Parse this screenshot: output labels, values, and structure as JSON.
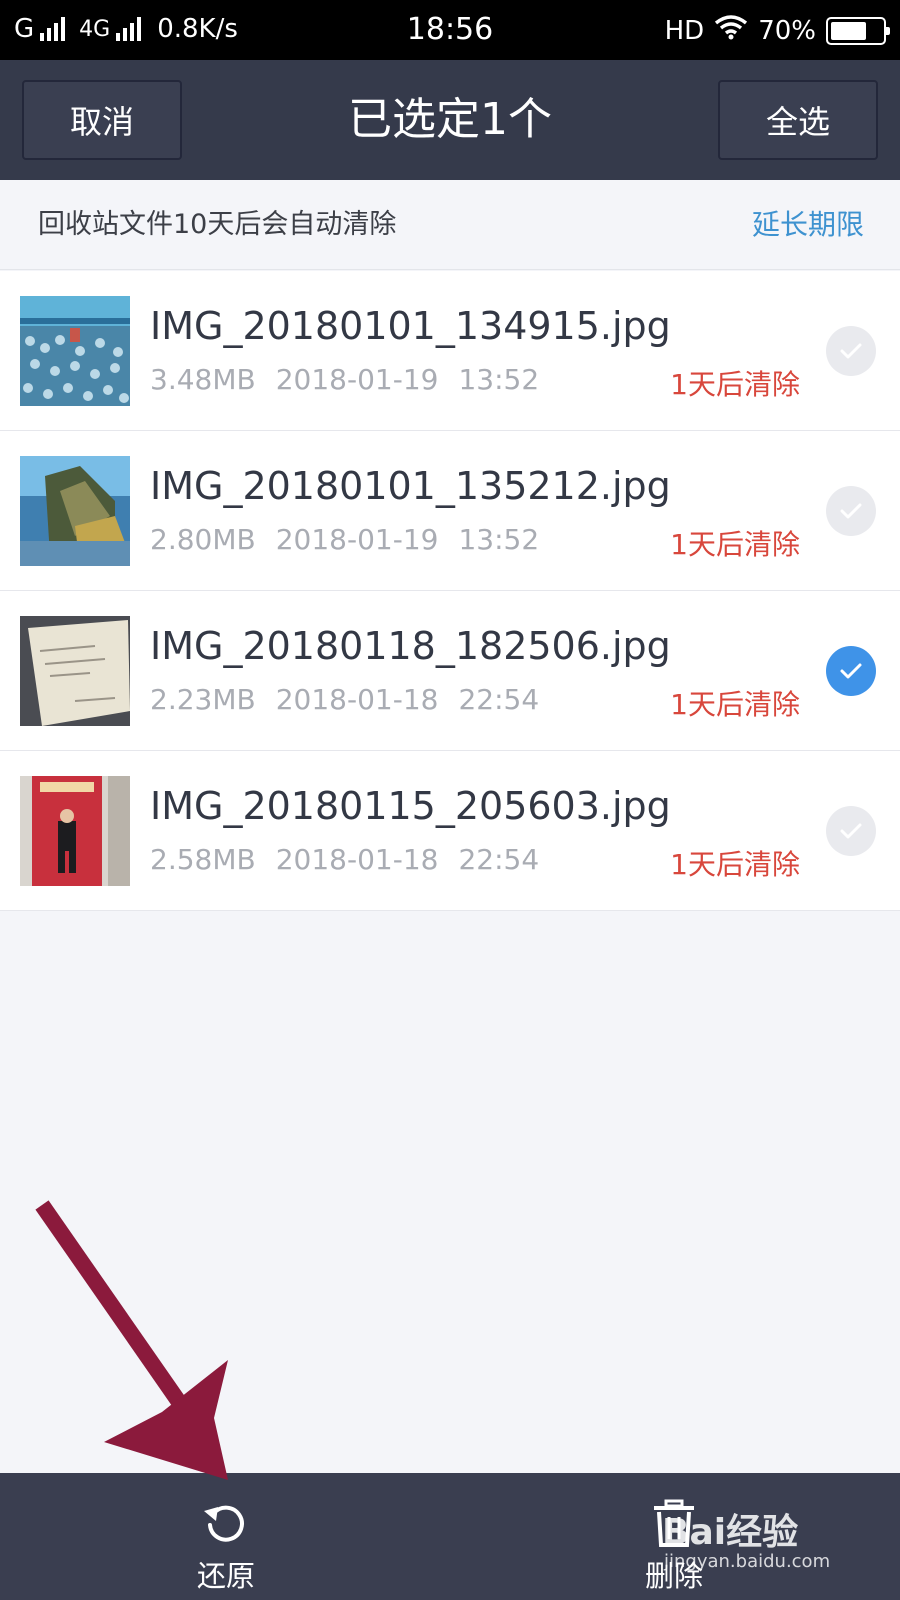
{
  "status_bar": {
    "carrier1": "G",
    "carrier2": "4G",
    "speed": "0.8K/s",
    "time": "18:56",
    "hd": "HD",
    "battery": "70%",
    "battery_level": 0.7
  },
  "header": {
    "cancel_label": "取消",
    "title": "已选定1个",
    "select_all_label": "全选"
  },
  "notice": {
    "text": "回收站文件10天后会自动清除",
    "extend_label": "延长期限"
  },
  "files": [
    {
      "name": "IMG_20180101_134915.jpg",
      "size": "3.48MB",
      "date": "2018-01-19",
      "time": "13:52",
      "expire": "1天后清除",
      "selected": false,
      "thumb": "ball-pit-photo"
    },
    {
      "name": "IMG_20180101_135212.jpg",
      "size": "2.80MB",
      "date": "2018-01-19",
      "time": "13:52",
      "expire": "1天后清除",
      "selected": false,
      "thumb": "slide-photo"
    },
    {
      "name": "IMG_20180118_182506.jpg",
      "size": "2.23MB",
      "date": "2018-01-18",
      "time": "22:54",
      "expire": "1天后清除",
      "selected": true,
      "thumb": "card-photo"
    },
    {
      "name": "IMG_20180115_205603.jpg",
      "size": "2.58MB",
      "date": "2018-01-18",
      "time": "22:54",
      "expire": "1天后清除",
      "selected": false,
      "thumb": "red-poster-photo"
    }
  ],
  "toolbar": {
    "restore_label": "还原",
    "delete_label": "删除"
  },
  "watermark": {
    "logo": "Bai经验",
    "url": "jingyan.baidu.com"
  },
  "colors": {
    "header_bg": "#353a4b",
    "toolbar_bg": "#3a3e50",
    "accent_blue": "#3f93e8",
    "link_blue": "#3e92d0",
    "expire_red": "#d8473c",
    "annotation_arrow": "#8b1a3c"
  }
}
